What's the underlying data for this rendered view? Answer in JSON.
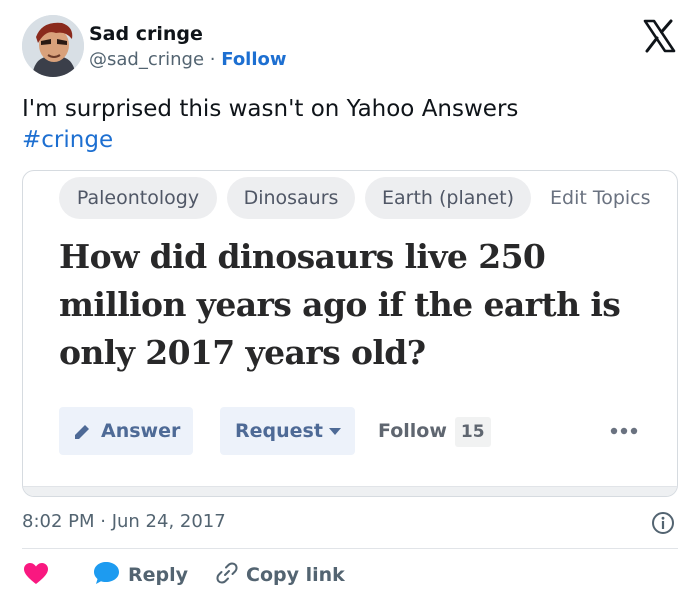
{
  "author": {
    "display_name": "Sad cringe",
    "handle": "@sad_cringe",
    "separator": "·",
    "follow_label": "Follow"
  },
  "tweet": {
    "text": "I'm surprised this wasn't on Yahoo Answers",
    "hashtag": "#cringe"
  },
  "embed": {
    "topics": [
      "Paleontology",
      "Dinosaurs",
      "Earth (planet)"
    ],
    "edit_topics_label": "Edit Topics",
    "question": "How did dinosaurs live 250 million years ago if the earth is only 2017 years old?",
    "answer_label": "Answer",
    "request_label": "Request",
    "follow_label": "Follow",
    "follow_count": "15"
  },
  "meta": {
    "timestamp": "8:02 PM · Jun 24, 2017"
  },
  "actions": {
    "reply_label": "Reply",
    "copy_link_label": "Copy link"
  },
  "colors": {
    "link": "#1d6fd1",
    "like": "#f91880",
    "reply": "#1d9bf0",
    "text_secondary": "#536471"
  },
  "icons": [
    "avatar",
    "x-logo-icon",
    "pencil-icon",
    "caret-down-icon",
    "more-dots-icon",
    "info-icon",
    "heart-icon",
    "reply-bubble-icon",
    "link-icon"
  ]
}
